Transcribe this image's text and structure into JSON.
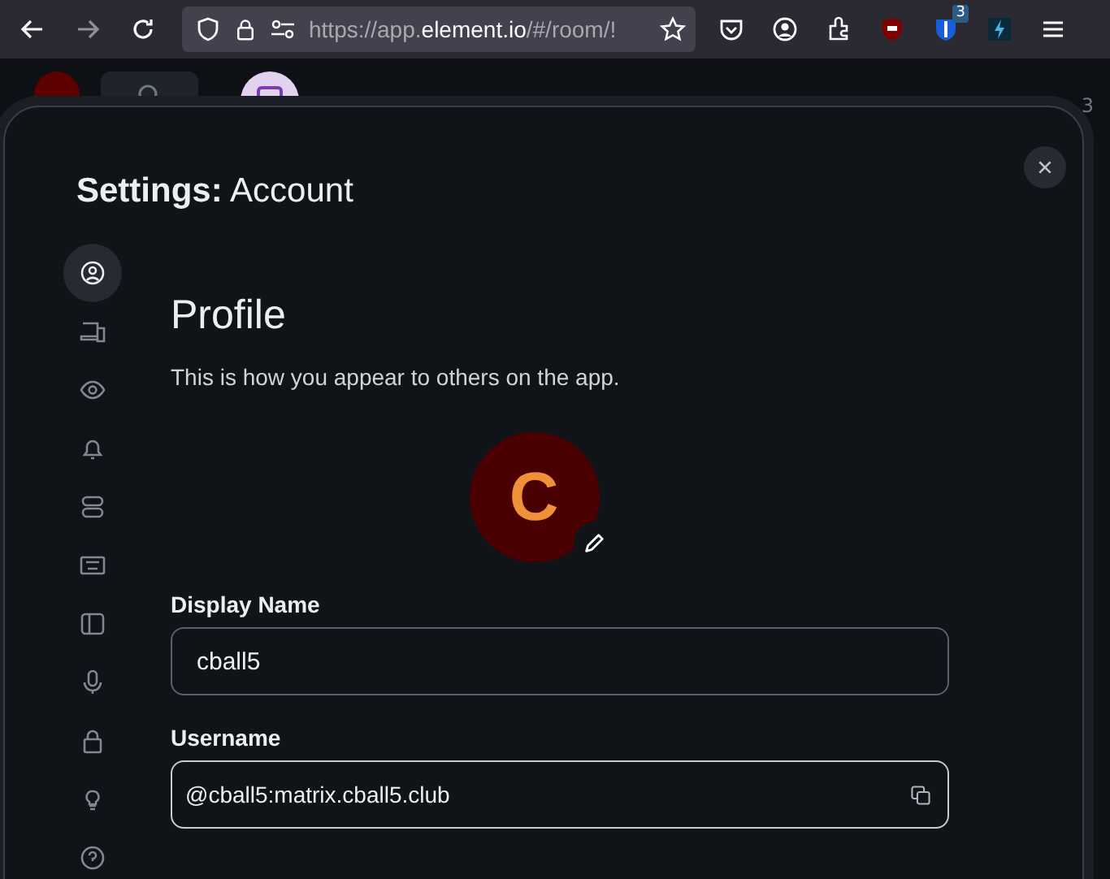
{
  "browser": {
    "url": {
      "before": "https://app.",
      "domain": "element.io",
      "after": "/#/room/!"
    },
    "extension_badge": "3"
  },
  "app_background": {
    "member_count": "3"
  },
  "dialog": {
    "title_bold": "Settings:",
    "title": "Account",
    "sidebar": {
      "items": [
        {
          "selected": true
        },
        {
          "selected": false
        },
        {
          "selected": false
        },
        {
          "selected": false
        },
        {
          "selected": false
        },
        {
          "selected": false
        },
        {
          "selected": false
        },
        {
          "selected": false
        },
        {
          "selected": false
        },
        {
          "selected": false
        },
        {
          "selected": false
        }
      ]
    },
    "heading": "Profile",
    "description": "This is how you appear to others on the app.",
    "avatar": {
      "initial": "C",
      "color": "#4a0000"
    },
    "fields": [
      {
        "kind": "text",
        "label": "Display Name",
        "value": "cball5"
      },
      {
        "kind": "copy",
        "label": "Username",
        "value": "@cball5:matrix.cball5.club"
      }
    ]
  }
}
